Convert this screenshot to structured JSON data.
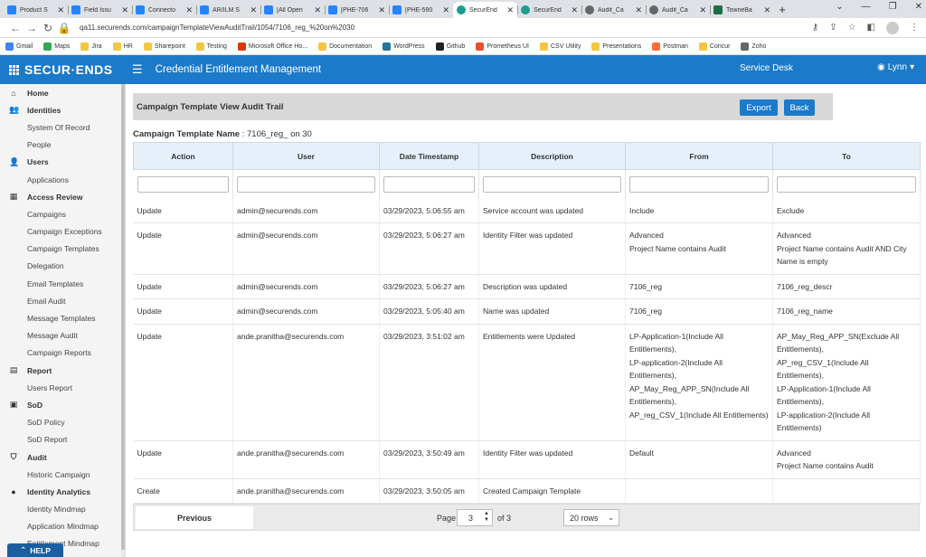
{
  "browser": {
    "tabs": [
      {
        "label": "Product S",
        "icon": "jira"
      },
      {
        "label": "Field Issu",
        "icon": "jira"
      },
      {
        "label": "Connecto",
        "icon": "jira"
      },
      {
        "label": "AR/ILM S",
        "icon": "jira"
      },
      {
        "label": "[All Open",
        "icon": "jira"
      },
      {
        "label": "[PHE-706",
        "icon": "jira"
      },
      {
        "label": "[PHE-590",
        "icon": "jira"
      },
      {
        "label": "SecurEnd",
        "icon": "securends",
        "active": true
      },
      {
        "label": "SecurEnd",
        "icon": "securends"
      },
      {
        "label": "Audit_Ca",
        "icon": "globe"
      },
      {
        "label": "Audit_Ca",
        "icon": "globe"
      },
      {
        "label": "TowneBa",
        "icon": "excel"
      }
    ],
    "new_tab": "+",
    "url": "qa11.securends.com/campaignTemplateViewAuditTrail/1054/7106_reg_%20on%2030",
    "bookmarks": [
      {
        "label": "Gmail",
        "icon": "google"
      },
      {
        "label": "Maps",
        "icon": "maps"
      },
      {
        "label": "Jira",
        "icon": "folder"
      },
      {
        "label": "HR",
        "icon": "folder"
      },
      {
        "label": "Sharepoint",
        "icon": "folder"
      },
      {
        "label": "Testing",
        "icon": "folder"
      },
      {
        "label": "Microsoft Office Ho...",
        "icon": "office"
      },
      {
        "label": "Documentation",
        "icon": "folder"
      },
      {
        "label": "WordPress",
        "icon": "wordpress"
      },
      {
        "label": "Github",
        "icon": "github"
      },
      {
        "label": "Prometheus UI",
        "icon": "prometheus"
      },
      {
        "label": "CSV Utility",
        "icon": "folder"
      },
      {
        "label": "Presentations",
        "icon": "folder"
      },
      {
        "label": "Postman",
        "icon": "postman"
      },
      {
        "label": "Concur",
        "icon": "folder"
      },
      {
        "label": "Zoho",
        "icon": "globe"
      }
    ]
  },
  "app": {
    "logo": "SECUR·ENDS",
    "title": "Credential Entitlement Management",
    "service_desk": "Service Desk",
    "user": "Lynn"
  },
  "sidebar": {
    "items": [
      {
        "label": "Home",
        "type": "head",
        "icon": "home-icon",
        "glyph": "⌂"
      },
      {
        "label": "Identities",
        "type": "head",
        "icon": "users-icon",
        "glyph": "👥"
      },
      {
        "label": "System Of Record",
        "type": "sub"
      },
      {
        "label": "People",
        "type": "sub"
      },
      {
        "label": "Users",
        "type": "head",
        "icon": "user-icon",
        "glyph": "👤"
      },
      {
        "label": "Applications",
        "type": "sub"
      },
      {
        "label": "Access Review",
        "type": "head",
        "icon": "grid-icon",
        "glyph": "▦"
      },
      {
        "label": "Campaigns",
        "type": "sub"
      },
      {
        "label": "Campaign Exceptions",
        "type": "sub"
      },
      {
        "label": "Campaign Templates",
        "type": "sub"
      },
      {
        "label": "Delegation",
        "type": "sub"
      },
      {
        "label": "Email Templates",
        "type": "sub"
      },
      {
        "label": "Email Audit",
        "type": "sub"
      },
      {
        "label": "Message Templates",
        "type": "sub"
      },
      {
        "label": "Message Audit",
        "type": "sub"
      },
      {
        "label": "Campaign Reports",
        "type": "sub"
      },
      {
        "label": "Report",
        "type": "head",
        "icon": "report-icon",
        "glyph": "▤"
      },
      {
        "label": "Users Report",
        "type": "sub"
      },
      {
        "label": "SoD",
        "type": "head",
        "icon": "sod-icon",
        "glyph": "▣"
      },
      {
        "label": "SoD Policy",
        "type": "sub"
      },
      {
        "label": "SoD Report",
        "type": "sub"
      },
      {
        "label": "Audit",
        "type": "head",
        "icon": "shield-icon",
        "glyph": "⛉"
      },
      {
        "label": "Historic Campaign",
        "type": "sub"
      },
      {
        "label": "Identity Analytics",
        "type": "head",
        "icon": "analytics-icon",
        "glyph": "●"
      },
      {
        "label": "Identity Mindmap",
        "type": "sub"
      },
      {
        "label": "Application Mindmap",
        "type": "sub"
      },
      {
        "label": "Entitlement Mindmap",
        "type": "sub"
      }
    ],
    "help": "HELP"
  },
  "page": {
    "header": "Campaign Template View Audit Trail",
    "export_label": "Export",
    "back_label": "Back",
    "template_name_label": "Campaign Template Name",
    "template_name_value": " : 7106_reg_ on 30"
  },
  "table": {
    "columns": [
      "Action",
      "User",
      "Date Timestamp",
      "Description",
      "From",
      "To"
    ],
    "rows": [
      [
        "Update",
        "admin@securends.com",
        "03/29/2023, 5:06:55 am",
        "Service account was updated",
        "Include",
        "Exclude"
      ],
      [
        "Update",
        "admin@securends.com",
        "03/29/2023, 5:06:27 am",
        "Identity Filter was updated",
        "Advanced\nProject Name contains Audit",
        "Advanced\nProject Name contains Audit AND City Name is empty"
      ],
      [
        "Update",
        "admin@securends.com",
        "03/29/2023, 5:06:27 am",
        "Description was updated",
        "7106_reg",
        "7106_reg_descr"
      ],
      [
        "Update",
        "admin@securends.com",
        "03/29/2023, 5:05:40 am",
        "Name was updated",
        "7106_reg",
        "7106_reg_name"
      ],
      [
        "Update",
        "ande.pranitha@securends.com",
        "03/29/2023, 3:51:02 am",
        "Entitlements were Updated",
        "LP-Application-1(Include All Entitlements),\nLP-application-2(Include All Entitlements),\nAP_May_Reg_APP_SN(Include All Entitlements),\nAP_reg_CSV_1(Include All Entitlements)",
        "AP_May_Reg_APP_SN(Exclude All Entitlements),\nAP_reg_CSV_1(Include All Entitlements),\nLP-Application-1(Include All Entitlements),\nLP-application-2(Include All Entitlements)"
      ],
      [
        "Update",
        "ande.pranitha@securends.com",
        "03/29/2023, 3:50:49 am",
        "Identity Filter was updated",
        "Default",
        "Advanced\nProject Name contains Audit"
      ],
      [
        "Create",
        "ande.pranitha@securends.com",
        "03/29/2023, 3:50:05 am",
        "Created Campaign Template",
        "",
        ""
      ]
    ]
  },
  "pager": {
    "previous_label": "Previous",
    "page_label": "Page",
    "page_value": "3",
    "of_label": "of 3",
    "rows_value": "20 rows"
  },
  "colors": {
    "brand": "#1b7ac9",
    "header_bg": "#e6f0fa"
  }
}
